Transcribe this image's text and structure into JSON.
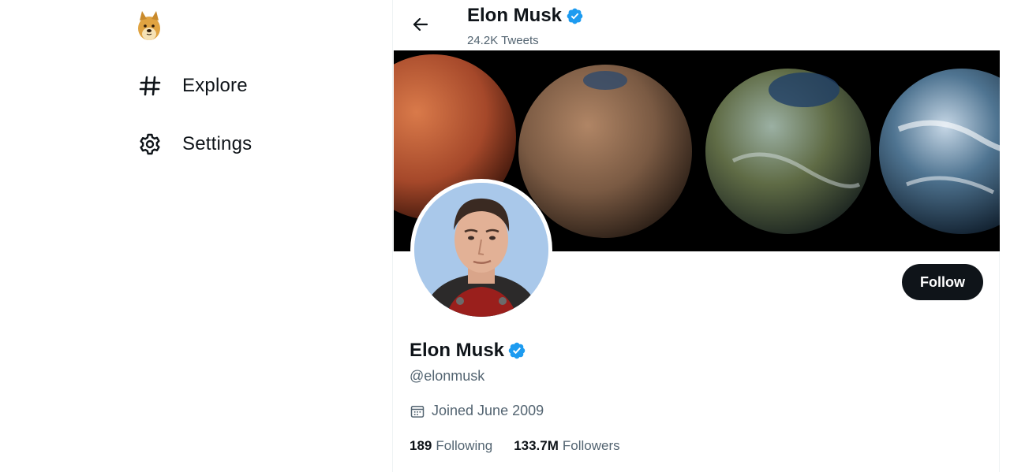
{
  "sidebar": {
    "logo_icon": "doge-logo-icon",
    "items": [
      {
        "label": "Explore",
        "icon": "hashtag-icon"
      },
      {
        "label": "Settings",
        "icon": "gear-icon"
      }
    ]
  },
  "header": {
    "back_icon": "back-arrow-icon",
    "name": "Elon Musk",
    "tweet_count": "24.2K Tweets"
  },
  "profile": {
    "name": "Elon Musk",
    "verified": true,
    "handle": "@elonmusk",
    "joined": "Joined June 2009",
    "following_count": "189",
    "following_label": "Following",
    "followers_count": "133.7M",
    "followers_label": "Followers",
    "follow_button": "Follow"
  },
  "colors": {
    "text_primary": "#0f1419",
    "text_secondary": "#536471",
    "verified_blue": "#1d9bf0",
    "follow_bg": "#0f1419"
  }
}
